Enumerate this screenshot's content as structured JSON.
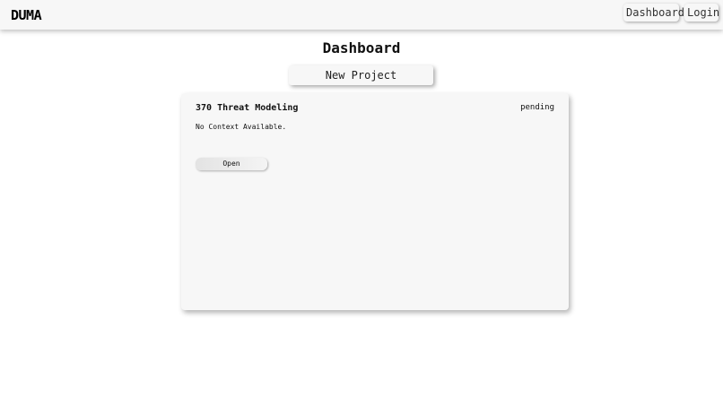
{
  "navbar": {
    "brand": "DUMA",
    "links": [
      "Dashboard",
      "Login"
    ]
  },
  "main": {
    "title": "Dashboard",
    "new_project_label": "New Project",
    "projects": [
      {
        "title": "370 Threat Modeling",
        "status": "pending",
        "context": "No Context Available.",
        "open_label": "Open"
      }
    ]
  }
}
